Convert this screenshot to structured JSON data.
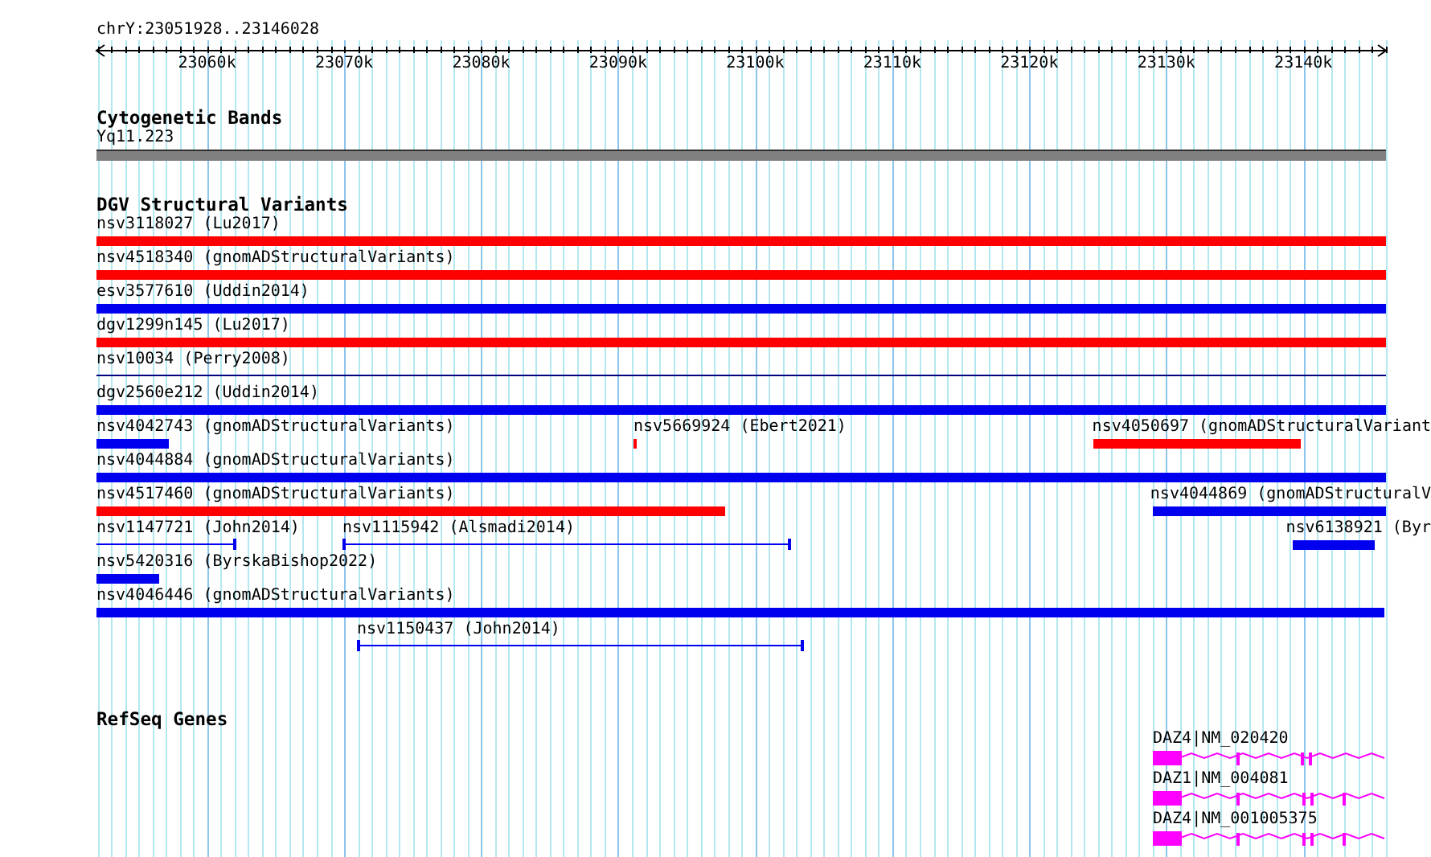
{
  "ruler": {
    "label": "chrY:23051928..23146028",
    "ticks": [
      "23060k",
      "23070k",
      "23080k",
      "23090k",
      "23100k",
      "23110k",
      "23120k",
      "23130k",
      "23140k"
    ]
  },
  "cytobands": {
    "title": "Cytogenetic Bands",
    "bands": [
      {
        "name": "Yq11.223"
      }
    ]
  },
  "dgv": {
    "title": "DGV Structural Variants",
    "rows": [
      {
        "features": [
          {
            "label": "nsv3118027 (Lu2017)",
            "kind": "bar",
            "color": "#ff0000"
          }
        ]
      },
      {
        "features": [
          {
            "label": "nsv4518340 (gnomADStructuralVariants)",
            "kind": "bar",
            "color": "#ff0000"
          }
        ]
      },
      {
        "features": [
          {
            "label": "esv3577610 (Uddin2014)",
            "kind": "bar",
            "color": "#0000ee"
          }
        ]
      },
      {
        "features": [
          {
            "label": "dgv1299n145 (Lu2017)",
            "kind": "bar",
            "color": "#ff0000"
          }
        ]
      },
      {
        "features": [
          {
            "label": "nsv10034 (Perry2008)",
            "kind": "line",
            "color": "#000080"
          }
        ]
      },
      {
        "features": [
          {
            "label": "dgv2560e212 (Uddin2014)",
            "kind": "bar",
            "color": "#0000ee"
          }
        ]
      },
      {
        "features": [
          {
            "label": "nsv4042743 (gnomADStructuralVariants)",
            "kind": "bar",
            "color": "#0000ee"
          },
          {
            "label": "nsv5669924 (Ebert2021)",
            "kind": "bar",
            "color": "#ff0000"
          },
          {
            "label": "nsv4050697 (gnomADStructuralVariant",
            "kind": "bar",
            "color": "#ff0000"
          }
        ]
      },
      {
        "features": [
          {
            "label": "nsv4044884 (gnomADStructuralVariants)",
            "kind": "bar",
            "color": "#0000ee"
          }
        ]
      },
      {
        "features": [
          {
            "label": "nsv4517460 (gnomADStructuralVariants)",
            "kind": "bar",
            "color": "#ff0000"
          },
          {
            "label": "nsv4044869 (gnomADStructuralV",
            "kind": "bar",
            "color": "#0000ee"
          }
        ]
      },
      {
        "features": [
          {
            "label": "nsv1147721 (John2014)",
            "kind": "line",
            "color": "#0000ee"
          },
          {
            "label": "nsv1115942 (Alsmadi2014)",
            "kind": "line",
            "color": "#0000ee"
          },
          {
            "label": "nsv6138921 (Byr",
            "kind": "bar",
            "color": "#0000ee"
          }
        ]
      },
      {
        "features": [
          {
            "label": "nsv5420316 (ByrskaBishop2022)",
            "kind": "bar",
            "color": "#0000ee"
          }
        ]
      },
      {
        "features": [
          {
            "label": "nsv4046446 (gnomADStructuralVariants)",
            "kind": "bar",
            "color": "#0000ee"
          }
        ]
      },
      {
        "features": [
          {
            "label": "nsv1150437 (John2014)",
            "kind": "line",
            "color": "#0000ee"
          }
        ]
      }
    ]
  },
  "refseq": {
    "title": "RefSeq Genes",
    "genes": [
      {
        "label": "DAZ4|NM_020420"
      },
      {
        "label": "DAZ1|NM_004081"
      },
      {
        "label": "DAZ4|NM_001005375"
      }
    ]
  }
}
